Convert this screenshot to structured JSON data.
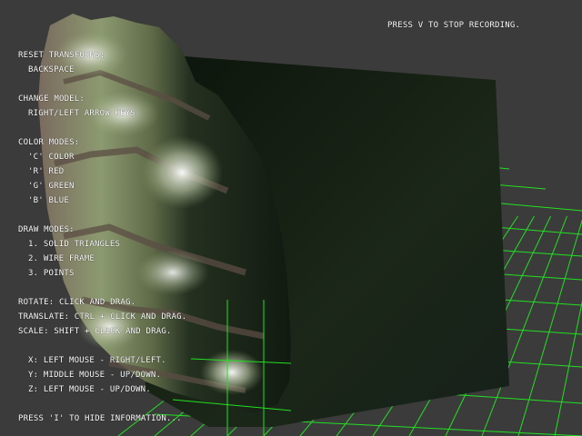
{
  "recording_notice": "PRESS V TO STOP RECORDING.",
  "info": {
    "reset_title": "RESET TRANSFORMS:",
    "reset_key": "BACKSPACE",
    "model_title": "CHANGE MODEL:",
    "model_keys": "RIGHT/LEFT ARROW KEYS",
    "color_title": "COLOR MODES:",
    "color_modes": [
      "'C' COLOR",
      "'R' RED",
      "'G' GREEN",
      "'B' BLUE"
    ],
    "draw_title": "DRAW MODES:",
    "draw_modes": [
      "1. SOLID TRIANGLES",
      "2. WIRE FRAME",
      "3. POINTS"
    ],
    "rotate": "ROTATE: CLICK AND DRAG.",
    "translate": "TRANSLATE: CTRL + CLICK AND DRAG.",
    "scale": "SCALE: SHIFT + CLICK AND DRAG.",
    "axis_x": "X: LEFT MOUSE - RIGHT/LEFT.",
    "axis_y": "Y: MIDDLE MOUSE - UP/DOWN.",
    "axis_z": "Z: LEFT MOUSE - UP/DOWN.",
    "hide_hint": "PRESS 'I' TO HIDE INFORMATION..."
  },
  "colors": {
    "background": "#3b3b3b",
    "grid": "#22e022",
    "terrain_high": "#f4f6ee",
    "terrain_mid": "#8fa070",
    "terrain_low": "#6e5e54",
    "terrain_shadow": "#141c12",
    "text": "#ffffff"
  }
}
